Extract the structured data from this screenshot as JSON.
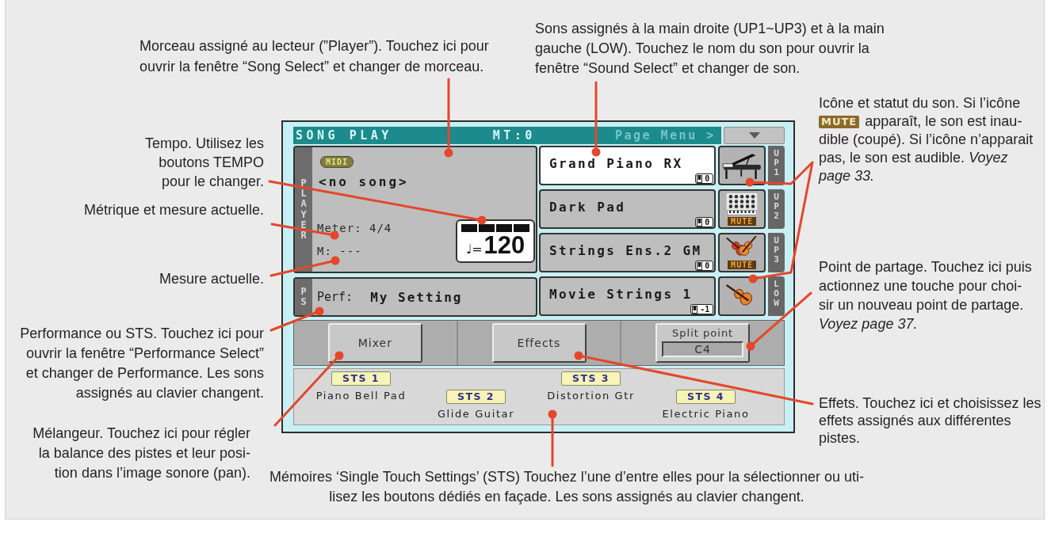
{
  "notes_top": [
    {
      "text": "Morceau assigné au lecteur (”Player”). Touchez ici pour\nouvrir la fenêtre “Song Select” et changer de morceau."
    },
    {
      "text": "Sons assignés à la main droite (UP1~UP3) et à la main\ngauche (LOW). Touchez le nom du son pour ouvrir la\nfenêtre “Sound Select” et changer de son."
    }
  ],
  "notes_left": [
    {
      "text": "Tempo. Utilisez les\nboutons TEMPO\npour le changer."
    },
    {
      "text": "Métrique et mesure actuelle."
    },
    {
      "text": "Mesure actuelle."
    },
    {
      "text": "Performance ou STS. Touchez ici pour\nouvrir la fenêtre “Performance Select”\net changer de Performance. Les sons\nassignés au clavier changent."
    },
    {
      "text": "Mélangeur. Touchez ici pour régler\nla balance des pistes et leur posi-\ntion dans l’image sonore (pan)."
    }
  ],
  "screen": {
    "title": "SONG PLAY",
    "transpose": "MT:0",
    "menu_hint": "Page Menu >",
    "player": {
      "section": "PLAYER",
      "badge": "MIDI",
      "song": "<no song>",
      "meter": "Meter: 4/4",
      "measure": "M: ---",
      "tempo": {
        "symbol": "♩=",
        "value": "120",
        "beats": [
          {
            "on": true
          },
          {
            "on": true
          },
          {
            "on": true
          },
          {
            "on": true
          }
        ]
      }
    },
    "performance": {
      "section": "PS",
      "label": "Perf:",
      "name": "My Setting"
    },
    "sounds": [
      {
        "name": "Grand Piano RX",
        "octave": "0",
        "kind": "piano",
        "muted": false,
        "part": "UP1",
        "selected": true
      },
      {
        "name": "Dark Pad",
        "octave": "0",
        "kind": "pad",
        "muted": true,
        "mute_label": "MUTE",
        "part": "UP2",
        "selected": false
      },
      {
        "name": "Strings Ens.2 GM",
        "octave": "0",
        "kind": "strings",
        "muted": true,
        "mute_label": "MUTE",
        "part": "UP3",
        "selected": false
      },
      {
        "name": "Movie Strings 1",
        "octave": "-1",
        "kind": "violin",
        "muted": false,
        "part": "LOW",
        "selected": false
      }
    ],
    "buttons": [
      {
        "kind": "button",
        "label": "Mixer"
      },
      {
        "kind": "button",
        "label": "Effects"
      },
      {
        "kind": "field",
        "label": "Split point",
        "value": "C4"
      }
    ],
    "sts": [
      {
        "label": "STS 1",
        "name": "Piano Bell Pad"
      },
      {
        "label": "STS 2",
        "name": "Glide Guitar"
      },
      {
        "label": "STS 3",
        "name": "Distortion Gtr"
      },
      {
        "label": "STS 4",
        "name": "Electric Piano"
      }
    ]
  },
  "notes_right": [
    {
      "intro": "Icône et statut du son. Si l’icône",
      "badge": "MUTE",
      "after_badge": "apparaît, le son est inau-",
      "text": "dible (coupé). Si l’icône n’apparait\npas, le son est audible. *Voyez*\n*page 33.*"
    },
    {
      "text": "Point de partage. Touchez ici puis\nactionnez une touche pour choi-\nsir un nouveau point de partage.\n*Voyez page 37.*"
    },
    {
      "text": "Effets. Touchez ici et choisissez les\neffets assignés aux différentes\npistes."
    }
  ],
  "note_bottom": {
    "text": "Mémoires ‘Single Touch Settings’ (STS) Touchez l’une d’entre elles pour la sélectionner ou uti-\nlisez les boutons dédiés en façade. Les sons assignés au clavier changent."
  }
}
